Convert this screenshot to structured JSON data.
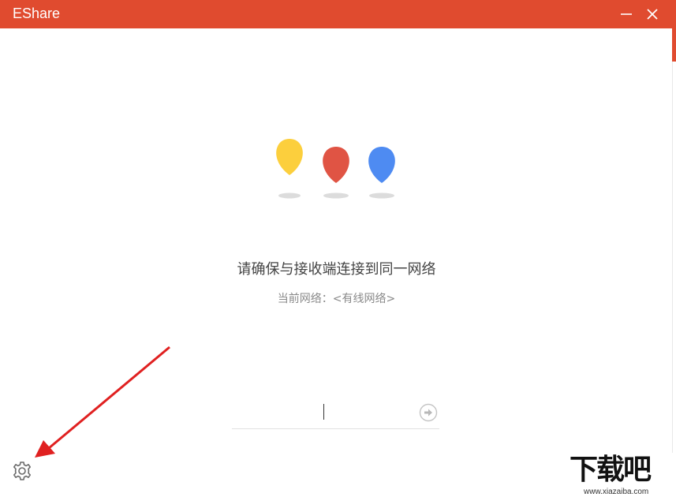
{
  "window": {
    "title": "EShare",
    "titlebar_color": "#e04b2f",
    "minimize_icon": "minimize-icon",
    "close_icon": "close-icon"
  },
  "logo": {
    "colors": [
      "#fccf3d",
      "#e05444",
      "#4e8bf2"
    ],
    "shadow_color": "#dcdcdc"
  },
  "main": {
    "heading": "请确保与接收端连接到同一网络",
    "network_label": "当前网络：<有线网络>"
  },
  "pin": {
    "value": "",
    "go_icon": "arrow-right-circle-icon"
  },
  "settings": {
    "icon": "gear-icon"
  },
  "annotation": {
    "arrow_color": "#e02020"
  },
  "watermark": {
    "text": "下载吧",
    "url": "www.xiazaiba.com"
  }
}
